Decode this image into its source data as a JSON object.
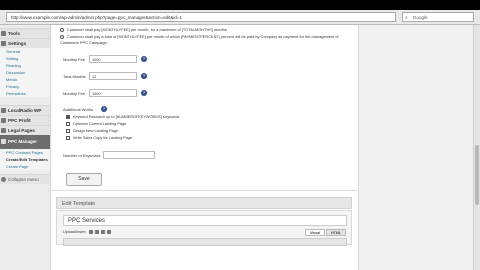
{
  "browser": {
    "url": "http://www.example.com/wp-admin/admin.php?page=ppc_manager&action=edit&id=1",
    "search": "Google"
  },
  "sidebar": {
    "top_items": [
      {
        "label": "Tools"
      },
      {
        "label": "Settings"
      }
    ],
    "settings_sub": [
      "General",
      "Writing",
      "Reading",
      "Discussion",
      "Media",
      "Privacy",
      "Permalinks"
    ],
    "plugins": [
      {
        "label": "LocalRadio WP"
      },
      {
        "label": "PPC Profit"
      },
      {
        "label": "Legal Pages"
      }
    ],
    "active": {
      "label": "PPC Manager"
    },
    "active_sub": [
      "PPC Contract Pages",
      "Create/Edit Templates",
      "Create Page"
    ],
    "collapse": "Collapse menu"
  },
  "form": {
    "radio_options": [
      "Customer shall pay [MONTHLYFEE] per month, for a maximum of [TOTALMONTHS] months",
      "Customer shall pay a total of [MONTHLYFEE] per month of which [PAYMENTPERCENT] percent will be paid by Company as payment for the management of Customers PPC Campaign."
    ],
    "fields": [
      {
        "label": "Monthly Fee",
        "value": "1000"
      },
      {
        "label": "Total Months",
        "value": "12"
      },
      {
        "label": "Monthly Fee",
        "value": "1000"
      }
    ],
    "additional_label": "Additional Works",
    "checkboxes": [
      {
        "label": "Keyword Research up to [NUMBEROFKEYWORDS] Keywords",
        "checked": true
      },
      {
        "label": "Optimize Current Landing Page",
        "checked": false
      },
      {
        "label": "Design New Landing Page",
        "checked": false
      },
      {
        "label": "Write Sales Copy for Landing Page",
        "checked": false
      }
    ],
    "keywords_label": "Number of Keywords",
    "save_label": "Save"
  },
  "template": {
    "header": "Edit Template",
    "title_value": "PPC Services",
    "upload_label": "Upload/Insert",
    "tab_visual": "Visual",
    "tab_html": "HTML"
  }
}
